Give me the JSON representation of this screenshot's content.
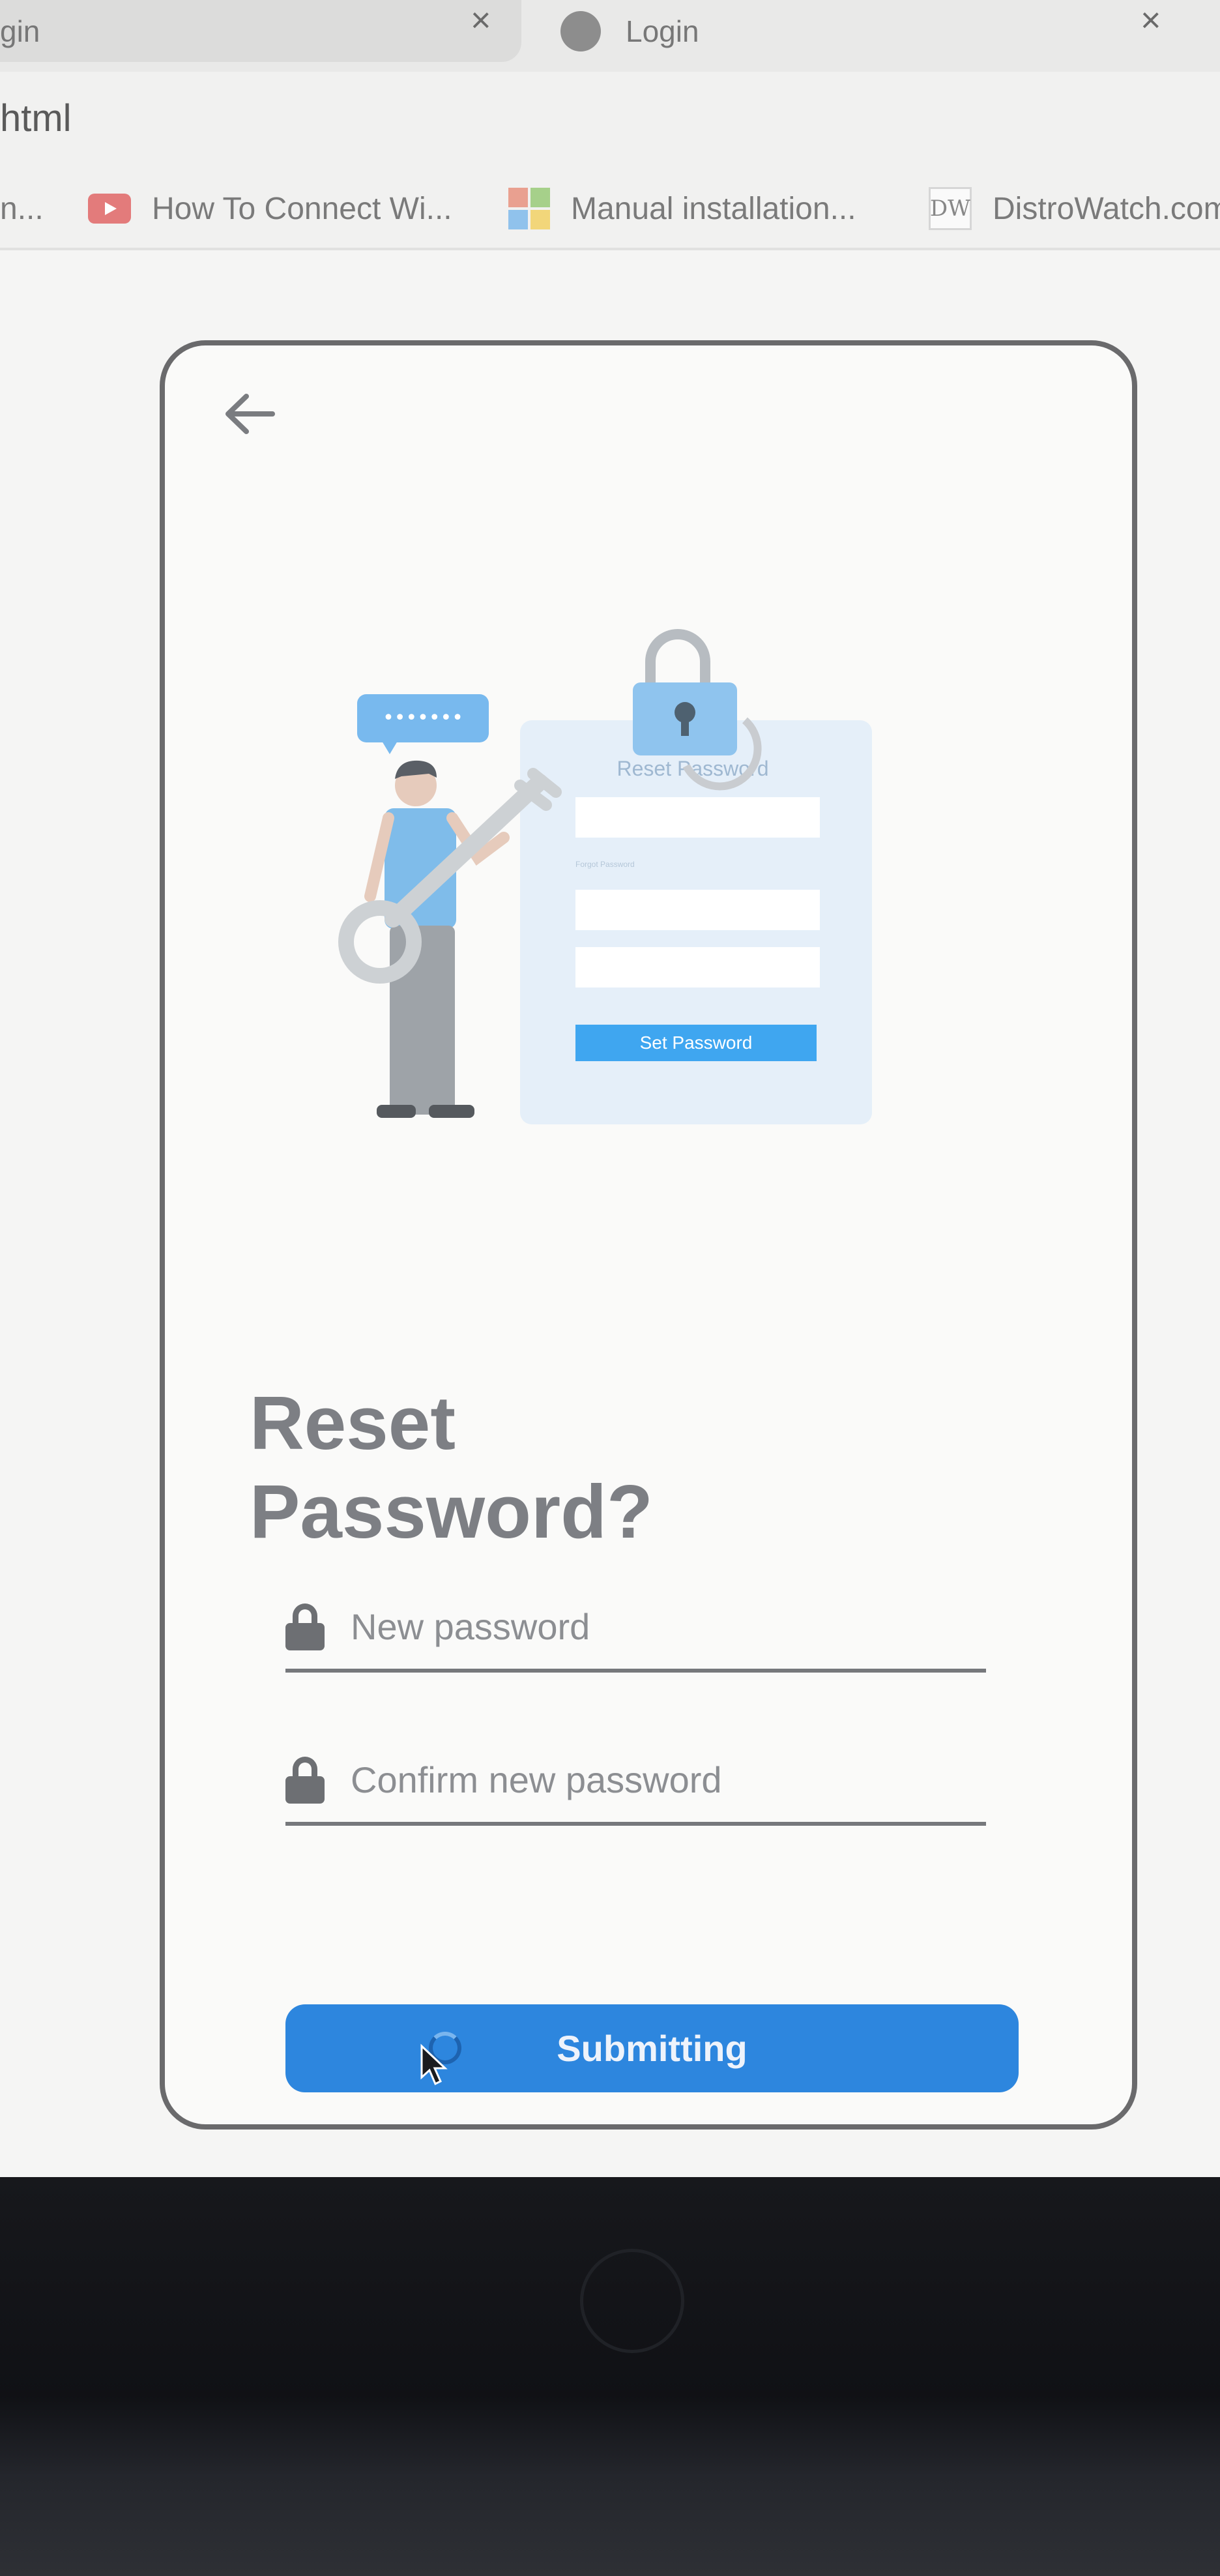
{
  "browser": {
    "tabs": [
      {
        "label": "gin",
        "close": "×"
      },
      {
        "label": "Login",
        "close": "×"
      }
    ],
    "url": "html",
    "bookmarks": [
      {
        "label": "n..."
      },
      {
        "label": "How To Connect Wi...",
        "icon": "youtube-icon"
      },
      {
        "label": "Manual installation...",
        "icon": "microsoft-icon"
      },
      {
        "label": "DistroWatch.com",
        "icon": "distrowatch-icon"
      }
    ]
  },
  "illustration": {
    "card_title": "Reset Password",
    "field_hint": "Forgot Password",
    "button_label": "Set Password",
    "bubble_text": "•••••••"
  },
  "form": {
    "title_line1": "Reset",
    "title_line2": "Password?",
    "new_password_placeholder": "New password",
    "confirm_password_placeholder": "Confirm new password",
    "submit_label": "Submitting"
  },
  "colors": {
    "primary": "#2d86de",
    "heading": "#7d7f84",
    "illustration_blue": "#a9d0f5"
  }
}
